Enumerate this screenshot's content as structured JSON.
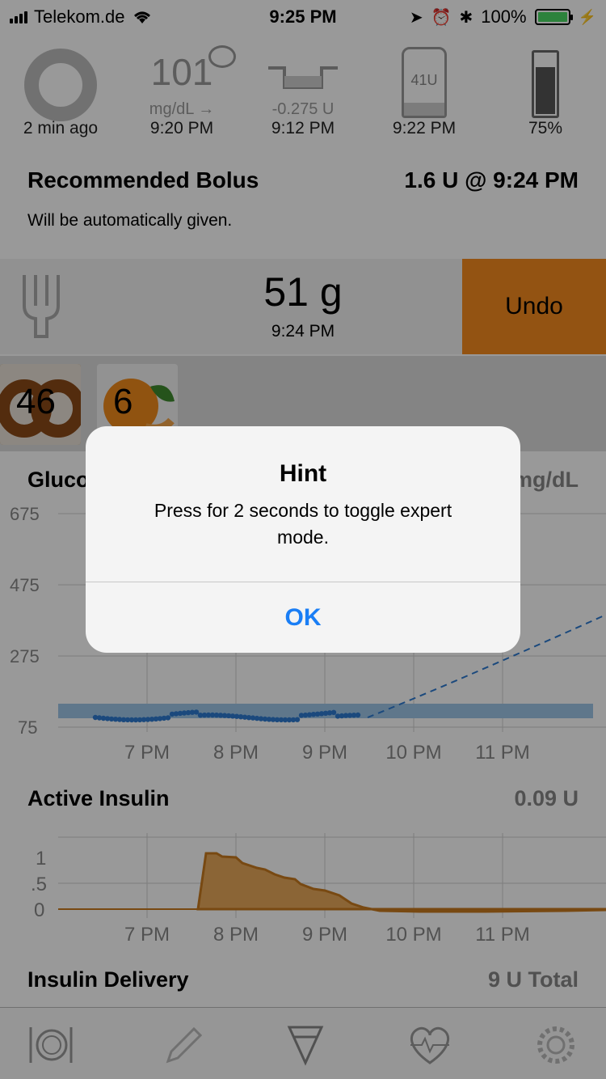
{
  "statusbar": {
    "carrier": "Telekom.de",
    "time": "9:25 PM",
    "battery": "100%"
  },
  "hud": {
    "loop_caption": "2 min ago",
    "glucose_value": "101",
    "glucose_unit": "mg/dL →",
    "glucose_time": "9:20 PM",
    "basal_value": "-0.275 U",
    "basal_time": "9:12 PM",
    "reservoir_label": "41U",
    "reservoir_time": "9:22 PM",
    "pump_battery": "75%"
  },
  "recommended": {
    "title": "Recommended Bolus",
    "value": "1.6 U @ 9:24 PM",
    "subtitle": "Will be automatically given."
  },
  "carbs": {
    "amount": "51 g",
    "time": "9:24 PM",
    "undo_label": "Undo"
  },
  "foods": [
    {
      "count": "46"
    },
    {
      "count": "6"
    }
  ],
  "glucose_chart": {
    "title": "Gluco",
    "unit": "mg/dL",
    "y_ticks": [
      "675",
      "475",
      "275",
      "75"
    ],
    "x_ticks": [
      "7 PM",
      "8 PM",
      "9 PM",
      "10 PM",
      "11 PM"
    ]
  },
  "insulin_chart": {
    "title": "Active Insulin",
    "value": "0.09 U",
    "y_ticks": [
      "1",
      ".5",
      "0"
    ],
    "x_ticks": [
      "7 PM",
      "8 PM",
      "9 PM",
      "10 PM",
      "11 PM"
    ]
  },
  "delivery": {
    "title": "Insulin Delivery",
    "value": "9 U Total"
  },
  "alert": {
    "title": "Hint",
    "message": "Press for 2 seconds to toggle expert mode.",
    "ok_label": "OK"
  },
  "colors": {
    "accent": "#f58a1f",
    "glucose_dots": "#2e7bd1",
    "target_band": "#9ec6e8",
    "insulin_fill": "#e8a95a",
    "alert_button": "#1a7ef5"
  }
}
